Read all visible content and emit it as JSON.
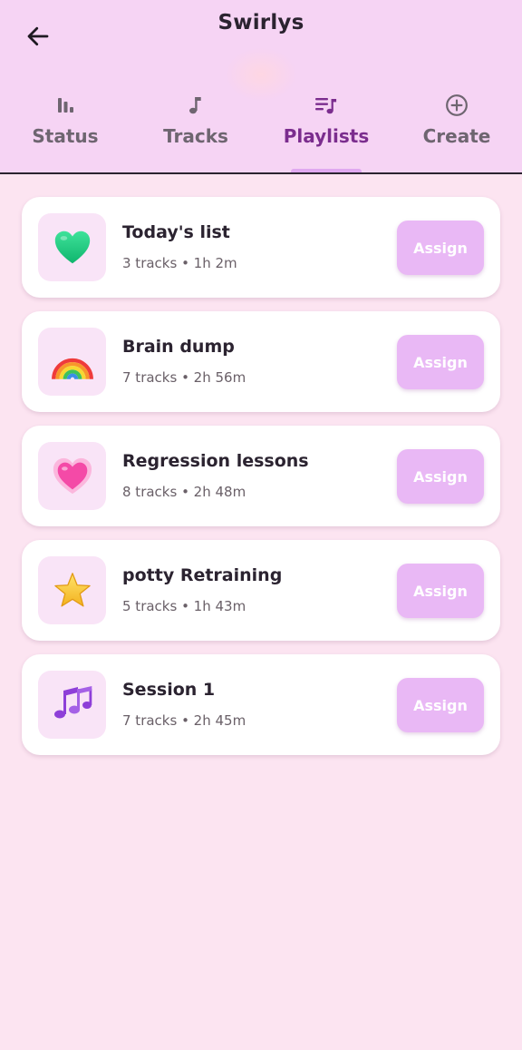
{
  "app": {
    "title": "Swirlys"
  },
  "icons": {
    "back": "arrow-left-icon",
    "status": "bar-chart-icon",
    "tracks": "music-note-icon",
    "playlists": "queue-music-icon",
    "create": "add-circle-icon"
  },
  "tabs": [
    {
      "label": "Status",
      "icon": "bar-chart-icon",
      "active": false
    },
    {
      "label": "Tracks",
      "icon": "music-note-icon",
      "active": false
    },
    {
      "label": "Playlists",
      "icon": "queue-music-icon",
      "active": true
    },
    {
      "label": "Create",
      "icon": "add-circle-icon",
      "active": false
    }
  ],
  "playlists": [
    {
      "name": "Today's list",
      "meta": "3 tracks • 1h 2m",
      "icon": "green-heart-icon",
      "action": "Assign"
    },
    {
      "name": "Brain dump",
      "meta": "7 tracks • 2h 56m",
      "icon": "rainbow-icon",
      "action": "Assign"
    },
    {
      "name": "Regression lessons",
      "meta": "8 tracks • 2h 48m",
      "icon": "sparkling-heart-icon",
      "action": "Assign"
    },
    {
      "name": "potty Retraining",
      "meta": "5 tracks • 1h 43m",
      "icon": "star-icon",
      "action": "Assign"
    },
    {
      "name": "Session 1",
      "meta": "7 tracks • 2h 45m",
      "icon": "music-notes-icon",
      "action": "Assign"
    }
  ],
  "colors": {
    "header_bg": "#f6d4f4",
    "page_bg": "#fce4f1",
    "accent": "#7b2d8e",
    "assign_button": "#e9b8f5",
    "tab_inactive": "#6e6570"
  }
}
